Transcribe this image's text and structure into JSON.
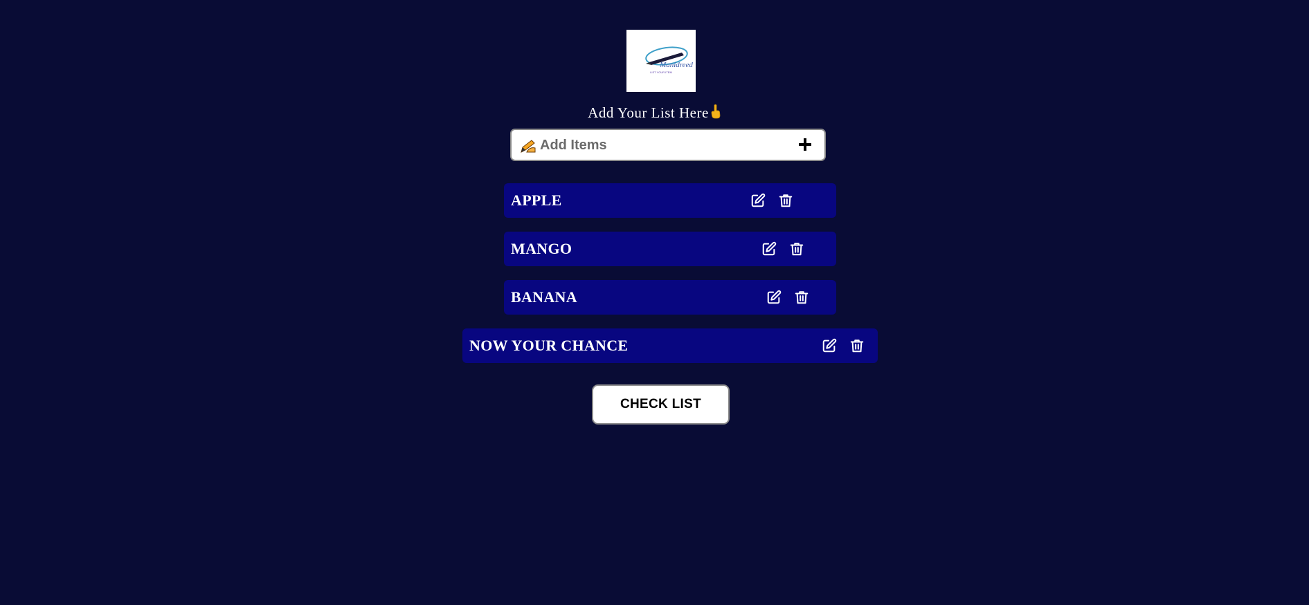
{
  "logo": {
    "brand_text": "Manidreed",
    "tagline": "LIST YOUR ITEM"
  },
  "heading": {
    "text": "Add Your List Here",
    "emoji": "👆"
  },
  "add_item": {
    "input_value": "",
    "placeholder": "Add Items",
    "input_icon": "writing-hand-icon",
    "add_icon": "plus-icon"
  },
  "items": [
    {
      "label": "APPLE"
    },
    {
      "label": "MANGO"
    },
    {
      "label": "BANANA"
    },
    {
      "label": "NOW YOUR CHANCE"
    }
  ],
  "item_icons": {
    "edit": "edit-icon",
    "delete": "trash-icon"
  },
  "check_list": {
    "label": "CHECK LIST"
  },
  "colors": {
    "background": "#090c35",
    "item_background": "#080680",
    "text": "#ffffff"
  }
}
